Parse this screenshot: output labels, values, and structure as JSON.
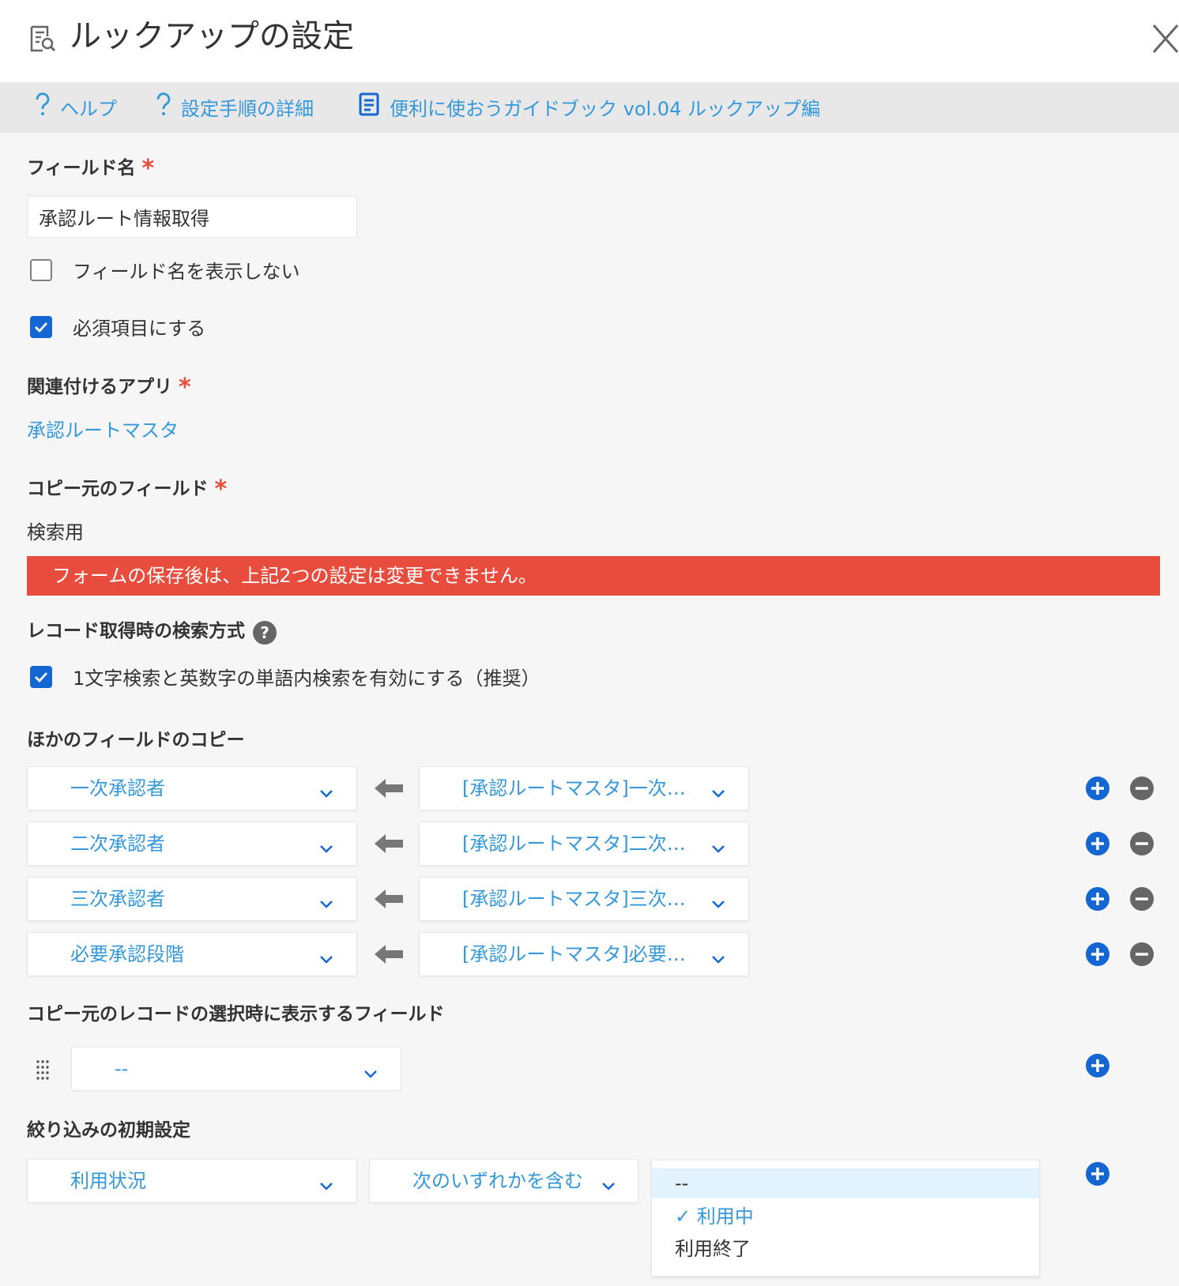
{
  "dialog": {
    "title": "ルックアップの設定",
    "icon": "lookup-settings-icon"
  },
  "links": [
    {
      "label": "ヘルプ",
      "icon": "help-icon"
    },
    {
      "label": "設定手順の詳細",
      "icon": "help-icon"
    },
    {
      "label": "便利に使おうガイドブック vol.04 ルックアップ編",
      "icon": "book-icon"
    }
  ],
  "field_name": {
    "label": "フィールド名",
    "required_mark": "*",
    "value": "承認ルート情報取得",
    "hide_name": {
      "label": "フィールド名を表示しない",
      "checked": false
    },
    "required": {
      "label": "必須項目にする",
      "checked": true
    }
  },
  "related_app": {
    "label": "関連付けるアプリ",
    "required_mark": "*",
    "value": "承認ルートマスタ"
  },
  "source_field": {
    "label": "コピー元のフィールド",
    "required_mark": "*",
    "value": "検索用"
  },
  "warning": "フォームの保存後は、上記2つの設定は変更できません。",
  "search_method": {
    "label": "レコード取得時の検索方式",
    "help": "?",
    "option": {
      "label": "1文字検索と英数字の単語内検索を有効にする（推奨）",
      "checked": true
    }
  },
  "copy_fields": {
    "label": "ほかのフィールドのコピー",
    "rows": [
      {
        "target": "一次承認者",
        "source": "[承認ルートマスタ]一次…"
      },
      {
        "target": "二次承認者",
        "source": "[承認ルートマスタ]二次…"
      },
      {
        "target": "三次承認者",
        "source": "[承認ルートマスタ]三次…"
      },
      {
        "target": "必要承認段階",
        "source": "[承認ルートマスタ]必要…"
      }
    ]
  },
  "display_fields": {
    "label": "コピー元のレコードの選択時に表示するフィールド",
    "value": "--"
  },
  "filter": {
    "label": "絞り込みの初期設定",
    "field": "利用状況",
    "condition": "次のいずれかを含む",
    "options": [
      {
        "label": "--",
        "selected": false,
        "highlighted": true
      },
      {
        "label": "利用中",
        "selected": true,
        "highlighted": false
      },
      {
        "label": "利用終了",
        "selected": false,
        "highlighted": false
      }
    ],
    "check_mark": "✓"
  },
  "colors": {
    "accent": "#3498db",
    "checkbox": "#1467d3",
    "add_button": "#1467d3",
    "remove_button": "#666666",
    "required": "#e74c3c",
    "warning_bg": "#e74c3c"
  }
}
